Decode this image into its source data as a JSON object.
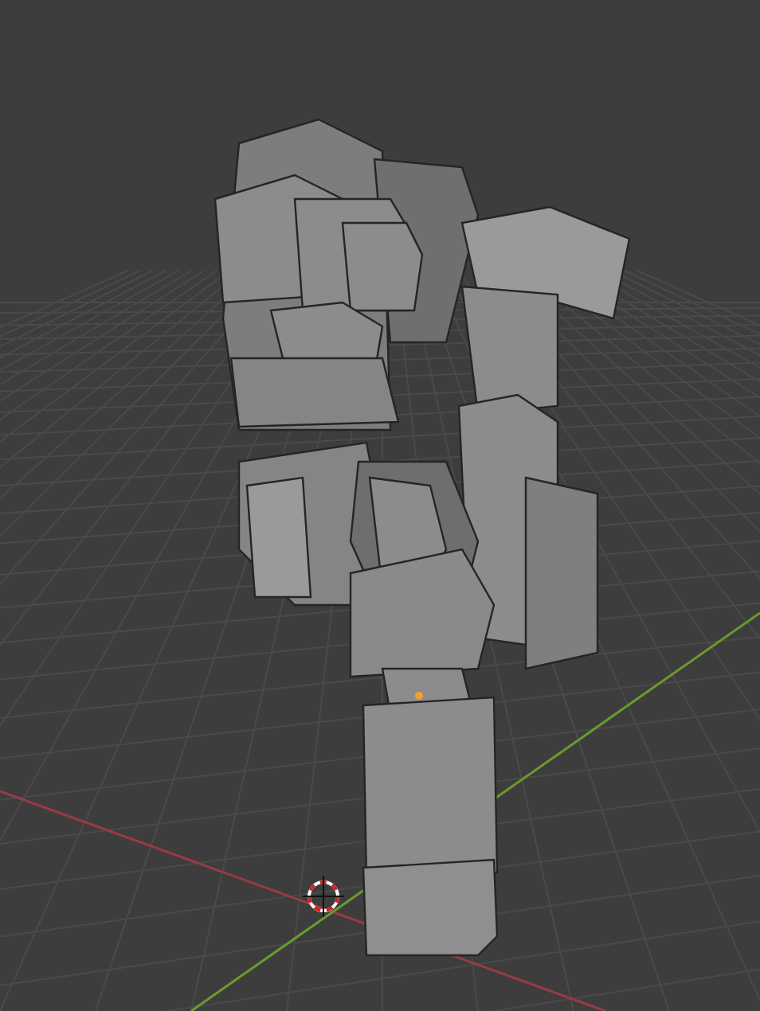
{
  "viewport": {
    "axes": [
      {
        "kind": "x",
        "color": "#9b3a44"
      },
      {
        "kind": "y",
        "color": "#6b9a2c"
      }
    ]
  }
}
